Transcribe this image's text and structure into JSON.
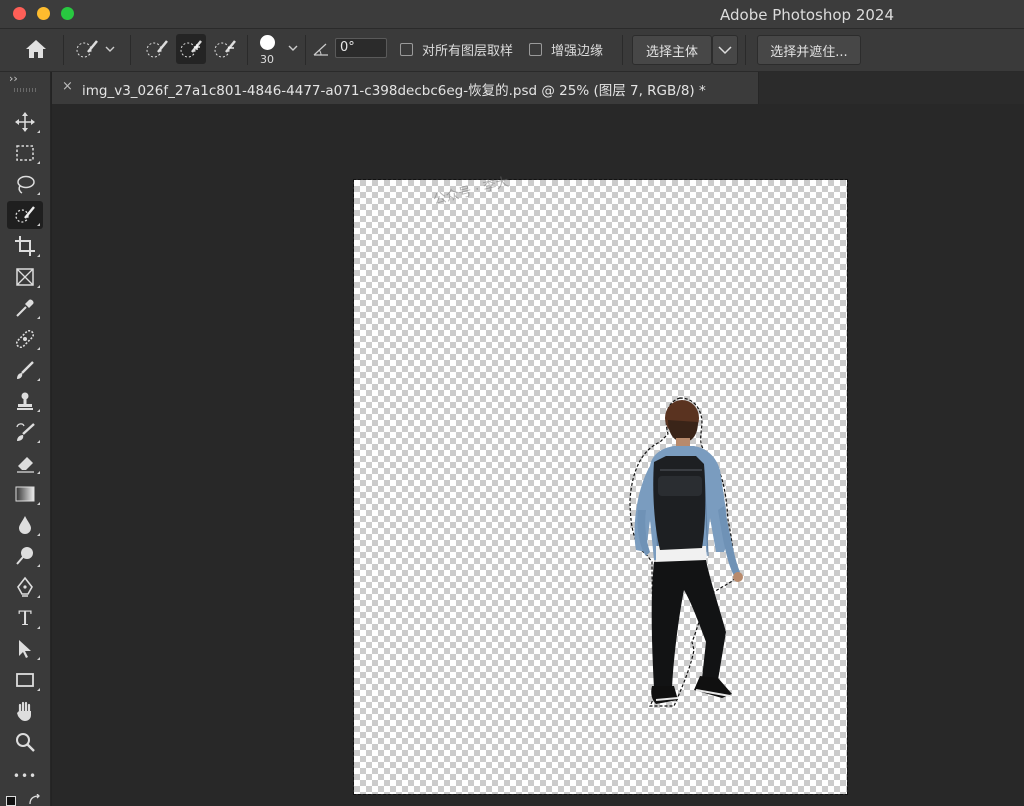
{
  "window": {
    "app_title": "Adobe Photoshop 2024"
  },
  "options_bar": {
    "brush_size": "30",
    "angle_value": "0°",
    "sample_all_layers_label": "对所有图层取样",
    "enhance_edge_label": "增强边缘",
    "select_subject_label": "选择主体",
    "select_and_mask_label": "选择并遮住..."
  },
  "toolbar": {
    "collapse_label": "››",
    "tools": [
      "move-tool",
      "marquee-tool",
      "lasso-tool",
      "quick-selection-tool",
      "crop-tool",
      "frame-tool",
      "eyedropper-tool",
      "healing-brush-tool",
      "brush-tool",
      "clone-stamp-tool",
      "history-brush-tool",
      "eraser-tool",
      "gradient-tool",
      "blur-tool",
      "dodge-tool",
      "pen-tool",
      "type-tool",
      "path-selection-tool",
      "rectangle-tool",
      "hand-tool",
      "zoom-tool",
      "more-tools"
    ],
    "active_tool": "quick-selection-tool",
    "type_tool_glyph": "T",
    "more_tools_glyph": "•••"
  },
  "document_tab": {
    "close_glyph": "×",
    "title": "img_v3_026f_27a1c801-4846-4477-a071-c398decbc6eg-恢复的.psd @ 25% (图层 7, RGB/8) *"
  },
  "canvas": {
    "watermark": "公众号 · 李大"
  }
}
